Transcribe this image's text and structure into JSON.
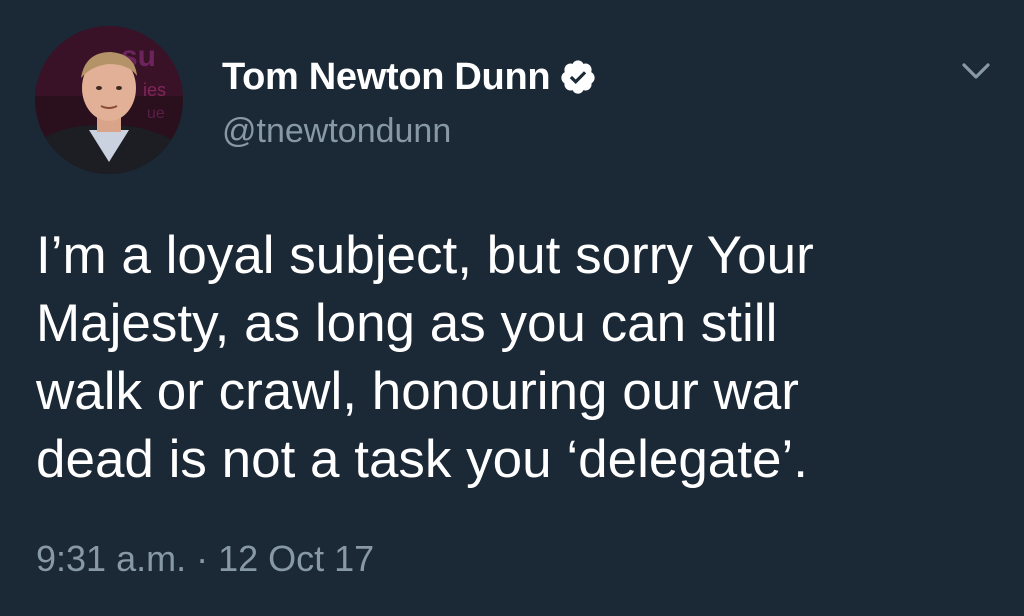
{
  "tweet": {
    "author": {
      "display_name": "Tom Newton Dunn",
      "handle": "@tnewtondunn",
      "verified": true,
      "avatar_icon": "profile-photo"
    },
    "text_lines": [
      "I’m a loyal subject, but sorry Your",
      "Majesty, as long as you can still",
      "walk or crawl, honouring our war",
      "dead is not a task you ‘delegate’."
    ],
    "timestamp": "9:31 a.m. · 12 Oct 17",
    "menu_icon": "chevron-down-icon"
  },
  "colors": {
    "background": "#1b2836",
    "primary_text": "#ffffff",
    "secondary_text": "#8899a6",
    "verified_badge": "#ffffff"
  }
}
